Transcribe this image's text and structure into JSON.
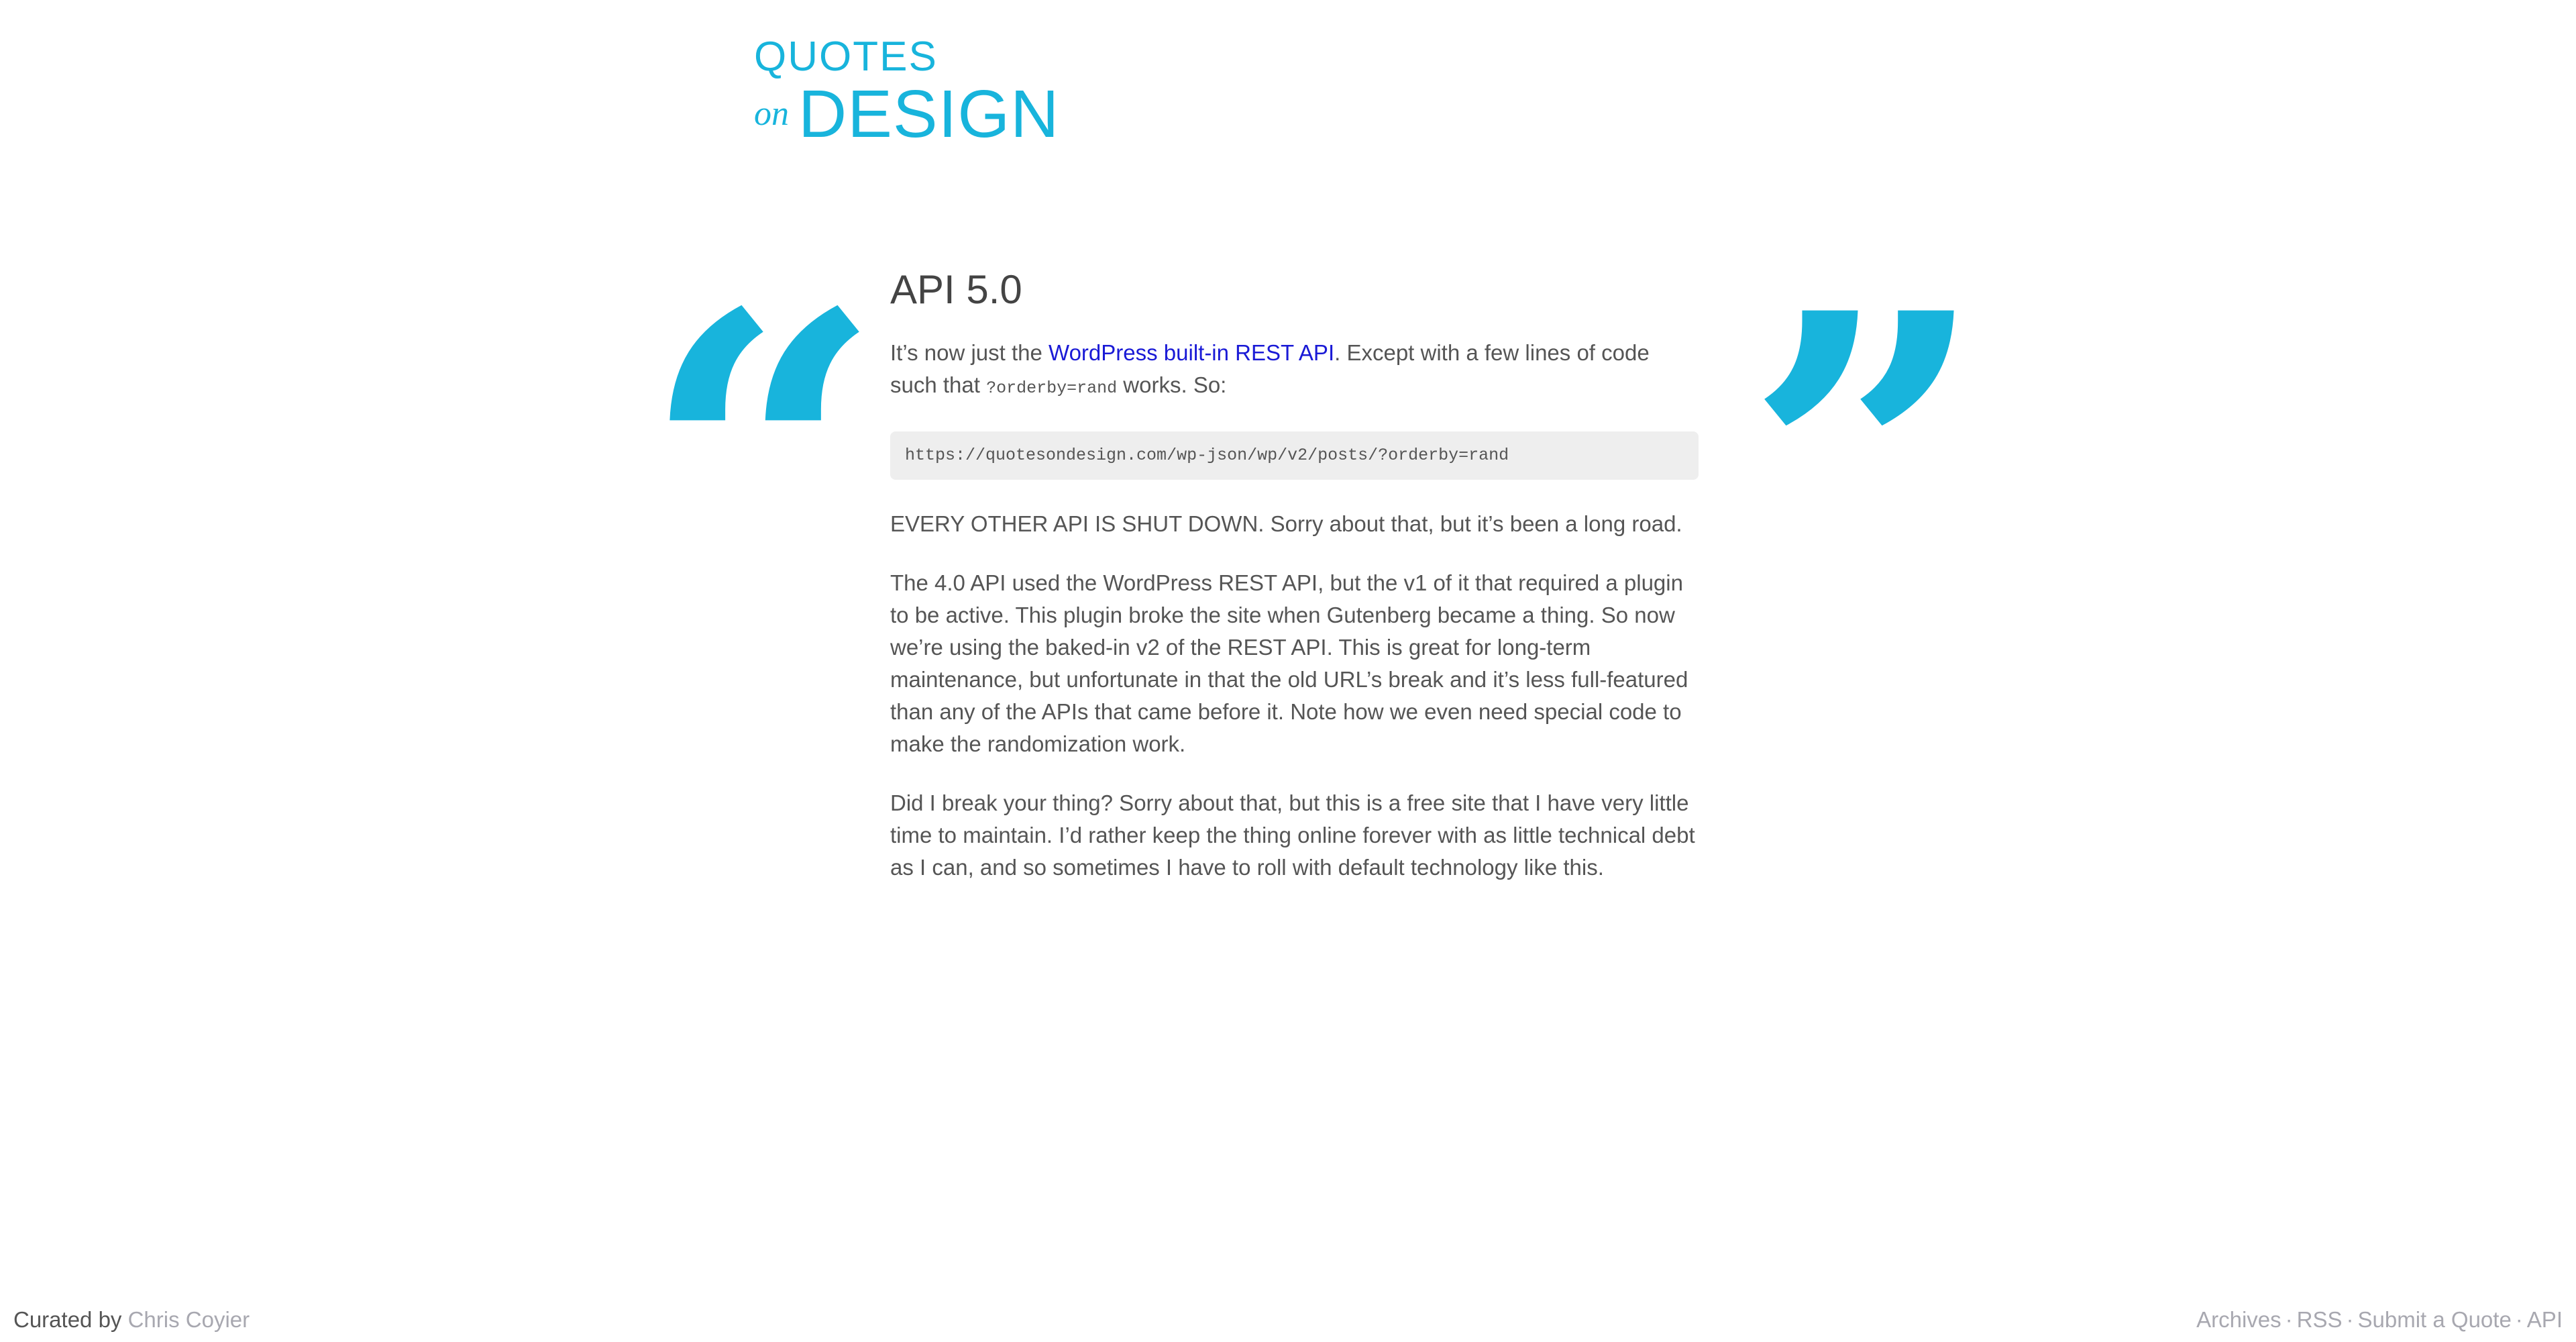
{
  "logo": {
    "line1": "QUOTES",
    "on": "on",
    "design": "DESIGN"
  },
  "quote_marks": {
    "open": "“",
    "close": "”"
  },
  "post": {
    "title": "API 5.0",
    "p1": {
      "before": "It’s now just the ",
      "link": "WordPress built-in REST API",
      "after1": ". Except with a few lines of code such that ",
      "code": "?orderby=rand",
      "after2": " works. So:"
    },
    "code_block": "https://quotesondesign.com/wp-json/wp/v2/posts/?orderby=rand",
    "p2": "EVERY OTHER API IS SHUT DOWN. Sorry about that, but it’s been a long road.",
    "p3": "The 4.0 API used the WordPress REST API, but the v1 of it that required a plugin to be active. This plugin broke the site when Gutenberg became a thing. So now we’re using the baked-in v2 of the REST API. This is great for long-term maintenance, but unfortunate in that the old URL’s break and it’s less full-featured than any of the APIs that came before it. Note how we even need special code to make the randomization work.",
    "p4": "Did I break your thing? Sorry about that, but this is a free site that I have very little time to maintain. I’d rather keep the thing online forever with as little technical debt as I can, and so sometimes I have to roll with default technology like this."
  },
  "footer": {
    "curated_by": "Curated by ",
    "author": "Chris Coyier",
    "nav": [
      "Archives",
      "RSS",
      "Submit a Quote",
      "API"
    ],
    "separator": "·"
  },
  "colors": {
    "brand": "#18b4dc",
    "link": "#1a1ad6",
    "text": "#555555",
    "muted": "#a8a8b0",
    "code_bg": "#eeeeee"
  }
}
